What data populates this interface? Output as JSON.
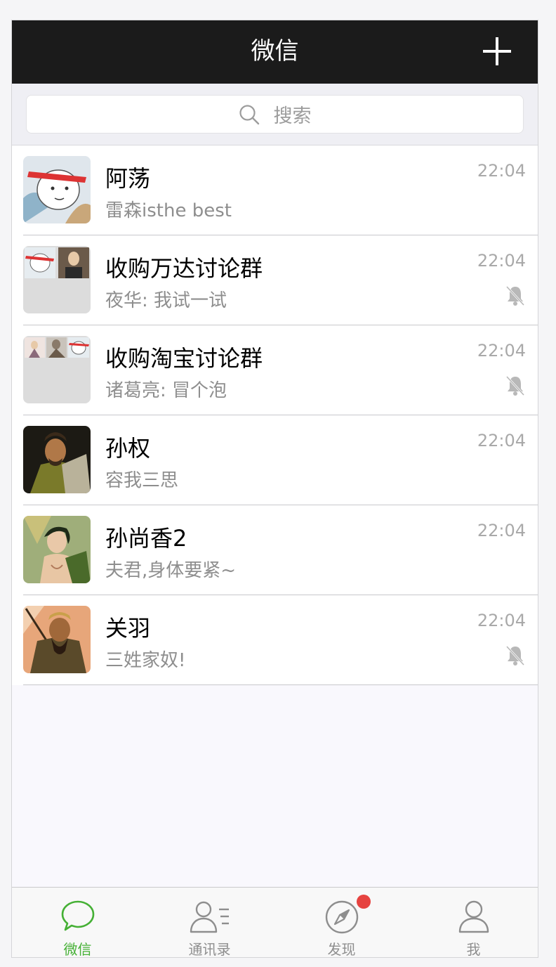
{
  "header": {
    "title": "微信"
  },
  "search": {
    "placeholder": "搜索"
  },
  "chats": [
    {
      "name": "阿荡",
      "preview": "雷森isthe best",
      "time": "22:04",
      "muted": false
    },
    {
      "name": "收购万达讨论群",
      "preview": "夜华: 我试一试",
      "time": "22:04",
      "muted": true
    },
    {
      "name": "收购淘宝讨论群",
      "preview": "诸葛亮: 冒个泡",
      "time": "22:04",
      "muted": true
    },
    {
      "name": "孙权",
      "preview": "容我三思",
      "time": "22:04",
      "muted": false
    },
    {
      "name": "孙尚香2",
      "preview": "夫君,身体要紧~",
      "time": "22:04",
      "muted": false
    },
    {
      "name": "关羽",
      "preview": "三姓家奴!",
      "time": "22:04",
      "muted": true
    }
  ],
  "tabs": [
    {
      "label": "微信",
      "icon": "chat-bubble-icon",
      "active": true
    },
    {
      "label": "通讯录",
      "icon": "contacts-icon",
      "active": false
    },
    {
      "label": "发现",
      "icon": "compass-icon",
      "active": false,
      "badge": true
    },
    {
      "label": "我",
      "icon": "person-icon",
      "active": false
    }
  ],
  "colors": {
    "navbar": "#1b1b1b",
    "accent": "#45b035",
    "badge": "#e64340",
    "background": "#f9f8fd"
  }
}
